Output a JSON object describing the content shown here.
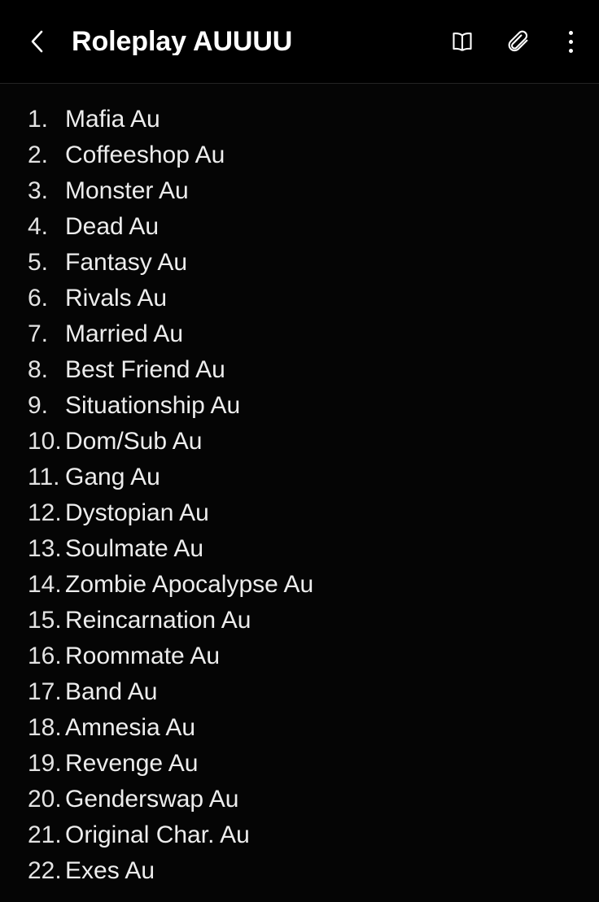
{
  "header": {
    "back_icon": "chevron-left-icon",
    "title": "Roleplay AUUUU",
    "actions": [
      {
        "icon": "book-icon",
        "name": "reading-mode-button"
      },
      {
        "icon": "paperclip-icon",
        "name": "attachment-button"
      },
      {
        "icon": "more-vertical-icon",
        "name": "more-options-button"
      }
    ]
  },
  "colors": {
    "background": "#050505",
    "appbar_background": "#000000",
    "divider": "#232323",
    "title_text": "#ffffff",
    "body_text": "#e7e7e7"
  },
  "note": {
    "list_type": "ordered",
    "items": [
      {
        "number": "1.",
        "label": "Mafia Au"
      },
      {
        "number": "2.",
        "label": "Coffeeshop Au"
      },
      {
        "number": "3.",
        "label": "Monster Au"
      },
      {
        "number": "4.",
        "label": "Dead Au"
      },
      {
        "number": "5.",
        "label": "Fantasy Au"
      },
      {
        "number": "6.",
        "label": "Rivals Au"
      },
      {
        "number": "7.",
        "label": "Married Au"
      },
      {
        "number": "8.",
        "label": "Best Friend Au"
      },
      {
        "number": "9.",
        "label": "Situationship Au"
      },
      {
        "number": "10.",
        "label": "Dom/Sub Au"
      },
      {
        "number": "11.",
        "label": "Gang Au"
      },
      {
        "number": "12.",
        "label": "Dystopian Au"
      },
      {
        "number": "13.",
        "label": "Soulmate Au"
      },
      {
        "number": "14.",
        "label": "Zombie Apocalypse Au"
      },
      {
        "number": "15.",
        "label": "Reincarnation Au"
      },
      {
        "number": "16.",
        "label": "Roommate Au"
      },
      {
        "number": "17.",
        "label": "Band Au"
      },
      {
        "number": "18.",
        "label": "Amnesia Au"
      },
      {
        "number": "19.",
        "label": "Revenge Au"
      },
      {
        "number": "20.",
        "label": "Genderswap Au"
      },
      {
        "number": "21.",
        "label": "Original Char. Au"
      },
      {
        "number": "22.",
        "label": "Exes Au"
      }
    ]
  }
}
